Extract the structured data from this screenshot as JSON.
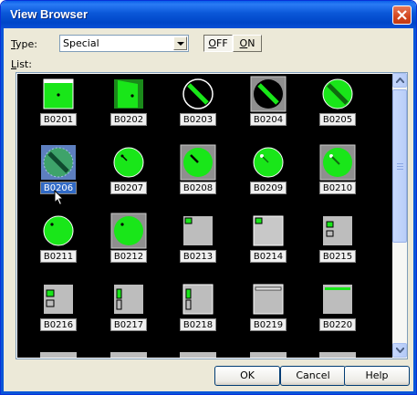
{
  "window": {
    "title": "View Browser"
  },
  "type_row": {
    "label_prefix": "T",
    "label_rest": "ype:",
    "selected_value": "Special",
    "off_prefix": "O",
    "off_rest": "FF",
    "on_prefix": "O",
    "on_rest": "N"
  },
  "list_row": {
    "label_prefix": "L",
    "label_rest": "ist:"
  },
  "items": [
    {
      "label": "B0201",
      "icon": "green-square-dot-white-top"
    },
    {
      "label": "B0202",
      "icon": "green-square-door"
    },
    {
      "label": "B0203",
      "icon": "black-circle-green-slash"
    },
    {
      "label": "B0204",
      "icon": "framed-black-circle-green-slash"
    },
    {
      "label": "B0205",
      "icon": "green-circle-dark-slash"
    },
    {
      "label": "B0206",
      "icon": "framed-green-circle-dark-slash-selected"
    },
    {
      "label": "B0207",
      "icon": "green-knob"
    },
    {
      "label": "B0208",
      "icon": "framed-green-knob"
    },
    {
      "label": "B0209",
      "icon": "green-knob-dot"
    },
    {
      "label": "B0210",
      "icon": "framed-green-knob-dot"
    },
    {
      "label": "B0211",
      "icon": "green-lamp"
    },
    {
      "label": "B0212",
      "icon": "framed-green-lamp"
    },
    {
      "label": "B0213",
      "icon": "gray-panel-green-corner"
    },
    {
      "label": "B0214",
      "icon": "gray-panel-green-corner-alt"
    },
    {
      "label": "B0215",
      "icon": "gray-panel-green-gray-squares"
    },
    {
      "label": "B0216",
      "icon": "gray-panel-green-gray-squares-alt"
    },
    {
      "label": "B0217",
      "icon": "gray-panel-vertical-pair"
    },
    {
      "label": "B0218",
      "icon": "gray-panel-vertical-pair-alt"
    },
    {
      "label": "B0219",
      "icon": "gray-panel-top-bar"
    },
    {
      "label": "B0220",
      "icon": "gray-panel-green-top-bar"
    }
  ],
  "selected_item": "B0206",
  "buttons": {
    "ok": "OK",
    "cancel": "Cancel",
    "help": "Help"
  },
  "colors": {
    "titlebar": "#0a57d8",
    "list_bg": "#000000",
    "green": "#19e619",
    "selection": "#316ac5"
  }
}
